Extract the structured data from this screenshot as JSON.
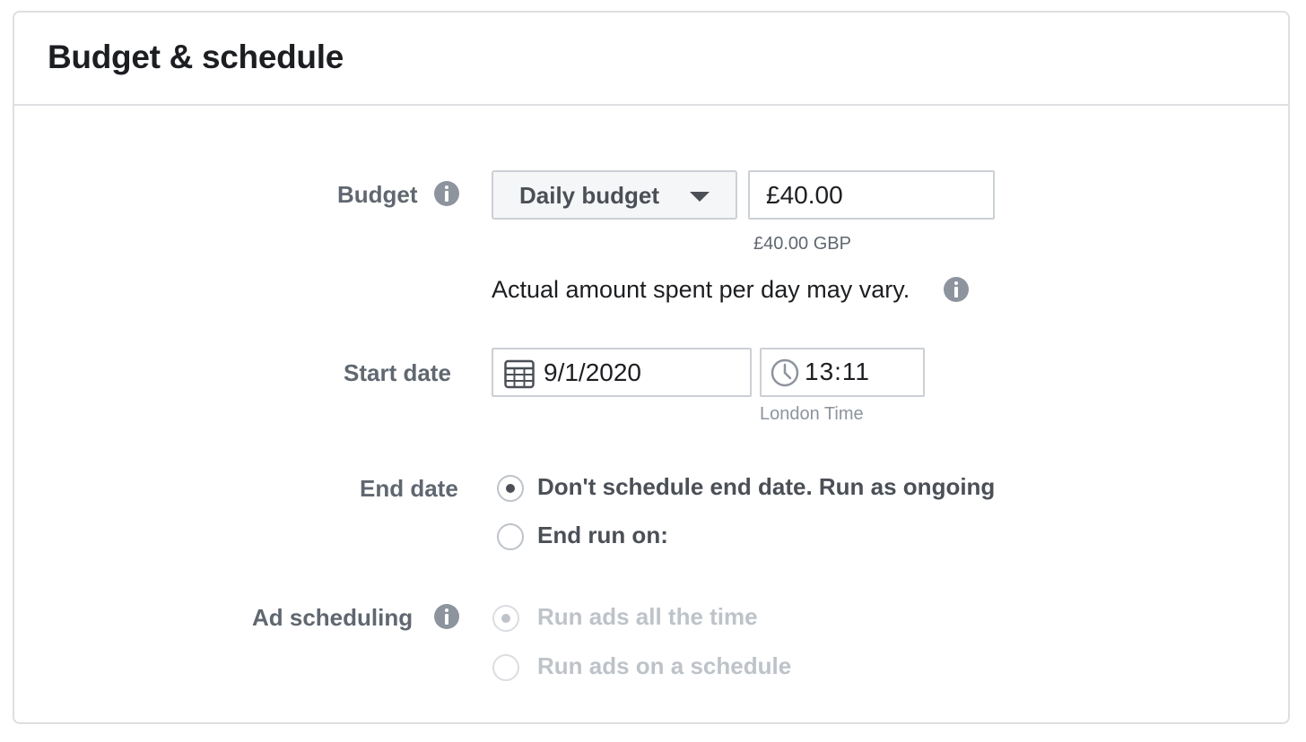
{
  "section": {
    "title": "Budget & schedule"
  },
  "budget": {
    "label": "Budget",
    "type_selected": "Daily budget",
    "amount": "£40.00",
    "amount_caption": "£40.00 GBP",
    "note": "Actual amount spent per day may vary."
  },
  "start_date": {
    "label": "Start date",
    "date": "9/1/2020",
    "time": "13:11",
    "timezone": "London Time"
  },
  "end_date": {
    "label": "End date",
    "options": [
      {
        "label": "Don't schedule end date. Run as ongoing",
        "selected": true
      },
      {
        "label": "End run on:",
        "selected": false
      }
    ]
  },
  "ad_scheduling": {
    "label": "Ad scheduling",
    "disabled": true,
    "options": [
      {
        "label": "Run ads all the time",
        "selected": true
      },
      {
        "label": "Run ads on a schedule",
        "selected": false
      }
    ]
  },
  "colors": {
    "label_gray": "#606770",
    "text_dark": "#1c1e21",
    "border": "#ccd0d5",
    "disabled": "#bec3c9",
    "icon_gray": "#8d949e"
  },
  "icons": [
    "info-icon",
    "caret-down-icon",
    "calendar-icon",
    "clock-icon"
  ]
}
